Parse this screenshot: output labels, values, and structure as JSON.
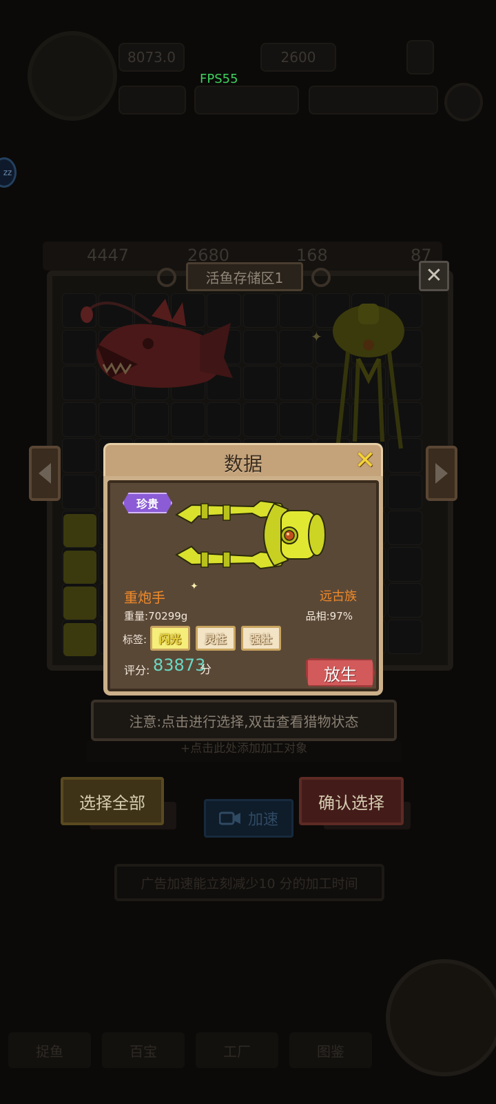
{
  "hud": {
    "fps": "FPS55",
    "coins": "8073.0",
    "gems": "2600"
  },
  "resources": [
    {
      "value": "4447"
    },
    {
      "value": "2680"
    },
    {
      "value": "168"
    },
    {
      "value": "87"
    }
  ],
  "storage": {
    "title": "活鱼存储区1"
  },
  "sleep_badge": "zz",
  "modal": {
    "title": "数据",
    "rarity": "珍贵",
    "fish_name": "重炮手",
    "race": "远古族",
    "weight_label": "重量:",
    "weight_value": "70299g",
    "quality_label": "品相:",
    "quality_value": "97%",
    "tags_label": "标签:",
    "tags": [
      "闪光",
      "灵性",
      "强壮"
    ],
    "score_label": "评分:",
    "score_value": "83873",
    "score_unit": "分",
    "release_label": "放生"
  },
  "notice": "注意:点击进行选择,双击查看猎物状态",
  "notice_sub": "+点击此处添加加工对象",
  "buttons": {
    "select_all": "选择全部",
    "confirm": "确认选择",
    "accelerate": "加速"
  },
  "accel_tip": "广告加速能立刻减少10 分的加工时间",
  "bottom_tabs": [
    "捉鱼",
    "百宝",
    "工厂",
    "图鉴"
  ],
  "colors": {
    "modal_header": "#c4a27a",
    "rarity_purple": "#8b5cd6",
    "name_orange": "#f08a2a",
    "score_teal": "#69d9c4",
    "release_red": "#d25a5a"
  }
}
